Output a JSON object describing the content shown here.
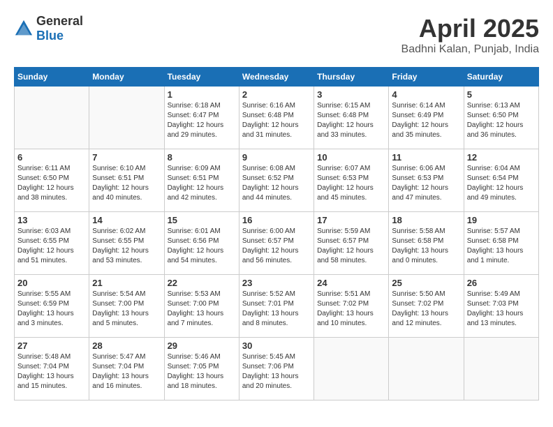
{
  "logo": {
    "general": "General",
    "blue": "Blue"
  },
  "title": {
    "month": "April 2025",
    "location": "Badhni Kalan, Punjab, India"
  },
  "calendar": {
    "headers": [
      "Sunday",
      "Monday",
      "Tuesday",
      "Wednesday",
      "Thursday",
      "Friday",
      "Saturday"
    ],
    "weeks": [
      {
        "days": [
          {
            "num": "",
            "info": ""
          },
          {
            "num": "",
            "info": ""
          },
          {
            "num": "1",
            "info": "Sunrise: 6:18 AM\nSunset: 6:47 PM\nDaylight: 12 hours and 29 minutes."
          },
          {
            "num": "2",
            "info": "Sunrise: 6:16 AM\nSunset: 6:48 PM\nDaylight: 12 hours and 31 minutes."
          },
          {
            "num": "3",
            "info": "Sunrise: 6:15 AM\nSunset: 6:48 PM\nDaylight: 12 hours and 33 minutes."
          },
          {
            "num": "4",
            "info": "Sunrise: 6:14 AM\nSunset: 6:49 PM\nDaylight: 12 hours and 35 minutes."
          },
          {
            "num": "5",
            "info": "Sunrise: 6:13 AM\nSunset: 6:50 PM\nDaylight: 12 hours and 36 minutes."
          }
        ]
      },
      {
        "days": [
          {
            "num": "6",
            "info": "Sunrise: 6:11 AM\nSunset: 6:50 PM\nDaylight: 12 hours and 38 minutes."
          },
          {
            "num": "7",
            "info": "Sunrise: 6:10 AM\nSunset: 6:51 PM\nDaylight: 12 hours and 40 minutes."
          },
          {
            "num": "8",
            "info": "Sunrise: 6:09 AM\nSunset: 6:51 PM\nDaylight: 12 hours and 42 minutes."
          },
          {
            "num": "9",
            "info": "Sunrise: 6:08 AM\nSunset: 6:52 PM\nDaylight: 12 hours and 44 minutes."
          },
          {
            "num": "10",
            "info": "Sunrise: 6:07 AM\nSunset: 6:53 PM\nDaylight: 12 hours and 45 minutes."
          },
          {
            "num": "11",
            "info": "Sunrise: 6:06 AM\nSunset: 6:53 PM\nDaylight: 12 hours and 47 minutes."
          },
          {
            "num": "12",
            "info": "Sunrise: 6:04 AM\nSunset: 6:54 PM\nDaylight: 12 hours and 49 minutes."
          }
        ]
      },
      {
        "days": [
          {
            "num": "13",
            "info": "Sunrise: 6:03 AM\nSunset: 6:55 PM\nDaylight: 12 hours and 51 minutes."
          },
          {
            "num": "14",
            "info": "Sunrise: 6:02 AM\nSunset: 6:55 PM\nDaylight: 12 hours and 53 minutes."
          },
          {
            "num": "15",
            "info": "Sunrise: 6:01 AM\nSunset: 6:56 PM\nDaylight: 12 hours and 54 minutes."
          },
          {
            "num": "16",
            "info": "Sunrise: 6:00 AM\nSunset: 6:57 PM\nDaylight: 12 hours and 56 minutes."
          },
          {
            "num": "17",
            "info": "Sunrise: 5:59 AM\nSunset: 6:57 PM\nDaylight: 12 hours and 58 minutes."
          },
          {
            "num": "18",
            "info": "Sunrise: 5:58 AM\nSunset: 6:58 PM\nDaylight: 13 hours and 0 minutes."
          },
          {
            "num": "19",
            "info": "Sunrise: 5:57 AM\nSunset: 6:58 PM\nDaylight: 13 hours and 1 minute."
          }
        ]
      },
      {
        "days": [
          {
            "num": "20",
            "info": "Sunrise: 5:55 AM\nSunset: 6:59 PM\nDaylight: 13 hours and 3 minutes."
          },
          {
            "num": "21",
            "info": "Sunrise: 5:54 AM\nSunset: 7:00 PM\nDaylight: 13 hours and 5 minutes."
          },
          {
            "num": "22",
            "info": "Sunrise: 5:53 AM\nSunset: 7:00 PM\nDaylight: 13 hours and 7 minutes."
          },
          {
            "num": "23",
            "info": "Sunrise: 5:52 AM\nSunset: 7:01 PM\nDaylight: 13 hours and 8 minutes."
          },
          {
            "num": "24",
            "info": "Sunrise: 5:51 AM\nSunset: 7:02 PM\nDaylight: 13 hours and 10 minutes."
          },
          {
            "num": "25",
            "info": "Sunrise: 5:50 AM\nSunset: 7:02 PM\nDaylight: 13 hours and 12 minutes."
          },
          {
            "num": "26",
            "info": "Sunrise: 5:49 AM\nSunset: 7:03 PM\nDaylight: 13 hours and 13 minutes."
          }
        ]
      },
      {
        "days": [
          {
            "num": "27",
            "info": "Sunrise: 5:48 AM\nSunset: 7:04 PM\nDaylight: 13 hours and 15 minutes."
          },
          {
            "num": "28",
            "info": "Sunrise: 5:47 AM\nSunset: 7:04 PM\nDaylight: 13 hours and 16 minutes."
          },
          {
            "num": "29",
            "info": "Sunrise: 5:46 AM\nSunset: 7:05 PM\nDaylight: 13 hours and 18 minutes."
          },
          {
            "num": "30",
            "info": "Sunrise: 5:45 AM\nSunset: 7:06 PM\nDaylight: 13 hours and 20 minutes."
          },
          {
            "num": "",
            "info": ""
          },
          {
            "num": "",
            "info": ""
          },
          {
            "num": "",
            "info": ""
          }
        ]
      }
    ]
  }
}
